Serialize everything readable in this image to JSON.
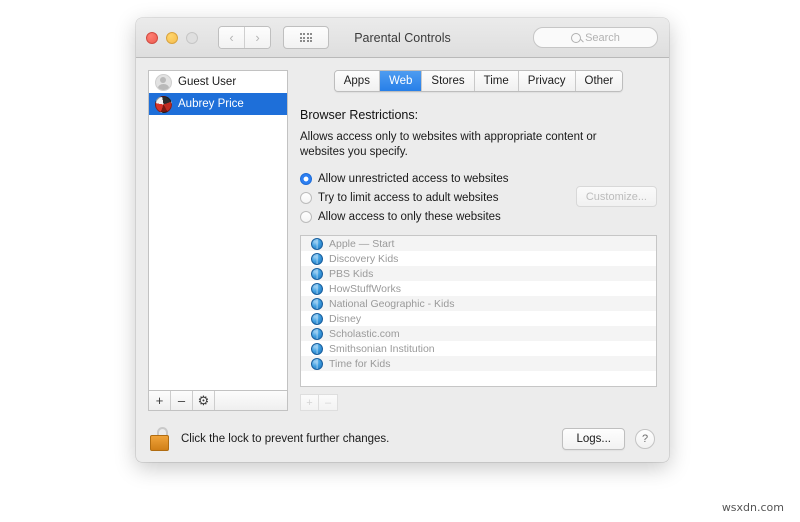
{
  "window": {
    "title": "Parental Controls",
    "traffic_lights": [
      "close-red",
      "minimize-yellow",
      "zoom-disabled"
    ],
    "nav_back": "‹",
    "nav_forward": "›",
    "show_all_icon": "grid-icon"
  },
  "search": {
    "placeholder": "Search",
    "value": "",
    "icon": "search-icon"
  },
  "sidebar": {
    "users": [
      {
        "name": "Guest User",
        "avatar": "guest-avatar",
        "selected": false
      },
      {
        "name": "Aubrey Price",
        "avatar": "user-avatar",
        "selected": true
      }
    ],
    "controls": {
      "add": "+",
      "remove": "–",
      "settings": "⚙"
    }
  },
  "tabs": [
    {
      "label": "Apps",
      "active": false
    },
    {
      "label": "Web",
      "active": true
    },
    {
      "label": "Stores",
      "active": false
    },
    {
      "label": "Time",
      "active": false
    },
    {
      "label": "Privacy",
      "active": false
    },
    {
      "label": "Other",
      "active": false
    }
  ],
  "main": {
    "section_title": "Browser Restrictions:",
    "section_description": "Allows access only to websites with appropriate content or websites you specify.",
    "radio_options": [
      {
        "label": "Allow unrestricted access to websites",
        "checked": true
      },
      {
        "label": "Try to limit access to adult websites",
        "checked": false
      },
      {
        "label": "Allow access to only these websites",
        "checked": false
      }
    ],
    "customize_label": "Customize...",
    "customize_enabled": false,
    "website_list": [
      "Apple — Start",
      "Discovery Kids",
      "PBS Kids",
      "HowStuffWorks",
      "National Geographic - Kids",
      "Disney",
      "Scholastic.com",
      "Smithsonian Institution",
      "Time for Kids"
    ],
    "list_controls": {
      "add": "+",
      "remove": "–"
    }
  },
  "footer": {
    "lock_icon": "unlocked-padlock-icon",
    "lock_text": "Click the lock to prevent further changes.",
    "logs_label": "Logs...",
    "help_label": "?"
  },
  "watermark": "wsxdn.com",
  "colors": {
    "accent_blue": "#2d7ff2",
    "selection_blue": "#1e6fd9",
    "window_bg": "#ececec",
    "lock_orange": "#d07f17"
  }
}
